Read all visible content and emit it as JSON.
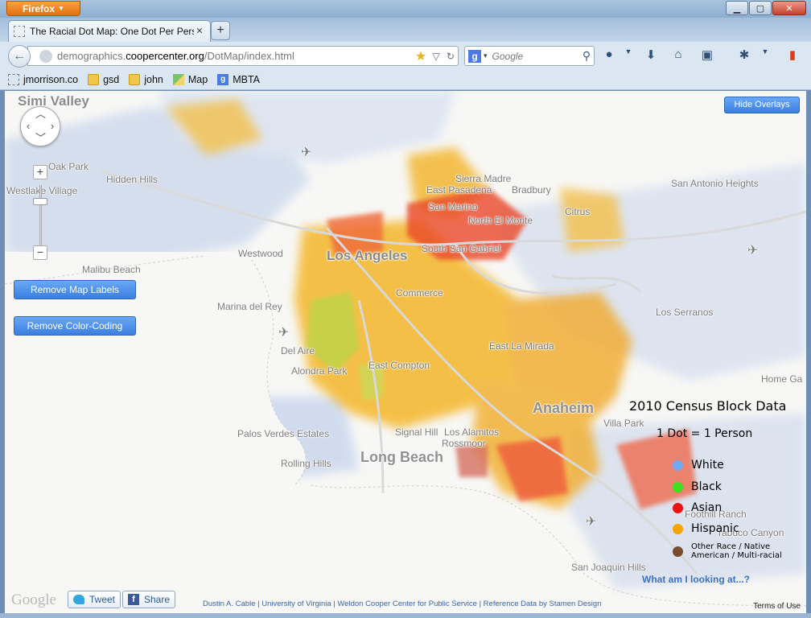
{
  "window": {
    "app_button": "Firefox",
    "controls": {
      "minimize": "▁",
      "maximize": "▢",
      "close": "✕"
    }
  },
  "tab": {
    "title": "The Racial Dot Map: One Dot Per Person...",
    "close": "✕",
    "new_tab": "+"
  },
  "nav": {
    "url_prefix": "demographics.",
    "url_domain": "coopercenter.org",
    "url_suffix": "/DotMap/index.html",
    "search_engine": "g",
    "search_placeholder": "Google"
  },
  "bookmarks": [
    {
      "label": "jmorrison.co",
      "icon": "page-icon"
    },
    {
      "label": "gsd",
      "icon": "folder-icon"
    },
    {
      "label": "john",
      "icon": "folder-icon"
    },
    {
      "label": "Map",
      "icon": "maps-icon"
    },
    {
      "label": "MBTA",
      "icon": "google-icon"
    }
  ],
  "map": {
    "buttons": {
      "hide_overlays": "Hide Overlays",
      "remove_labels": "Remove Map Labels",
      "remove_color": "Remove Color-Coding"
    },
    "zoom": {
      "in": "+",
      "out": "−"
    },
    "places": {
      "simi_valley": "Simi Valley",
      "oak_park": "Oak Park",
      "hidden_hills": "Hidden Hills",
      "westlake_village": "Westlake Village",
      "sierra_madre": "Sierra Madre",
      "east_pasadena": "East Pasadena",
      "bradbury": "Bradbury",
      "san_antonio_heights": "San Antonio Heights",
      "san_marino": "San Marino",
      "north_el_monte": "North El Monte",
      "citrus": "Citrus",
      "westwood": "Westwood",
      "los_angeles": "Los Angeles",
      "south_san_gabriel": "South San Gabriel",
      "malibu_beach": "Malibu Beach",
      "commerce": "Commerce",
      "marina_del_rey": "Marina del Rey",
      "los_serranos": "Los Serranos",
      "del_aire": "Del Aire",
      "east_la_mirada": "East La Mirada",
      "alondra_park": "Alondra Park",
      "east_compton": "East Compton",
      "home_gardens": "Home Ga",
      "anaheim": "Anaheim",
      "villa_park": "Villa Park",
      "signal_hill": "Signal Hill",
      "los_alamitos": "Los Alamitos",
      "palos_verdes_estates": "Palos Verdes Estates",
      "rossmoor": "Rossmoor",
      "rolling_hills": "Rolling Hills",
      "long_beach": "Long Beach",
      "foothill_ranch": "Foothill Ranch",
      "trabuco_canyon": "rabuco Canyon",
      "san_joaquin_hills": "San Joaquin Hills"
    }
  },
  "legend": {
    "title": "2010 Census Block Data",
    "subtitle": "1 Dot = 1 Person",
    "items": [
      {
        "label": "White",
        "color": "#73a9f2"
      },
      {
        "label": "Black",
        "color": "#3ee01f"
      },
      {
        "label": "Asian",
        "color": "#ee1111"
      },
      {
        "label": "Hispanic",
        "color": "#f5a300"
      }
    ],
    "other": {
      "line1": "Other Race / Native",
      "line2": "American / Multi-racial",
      "color": "#7a4b2c"
    },
    "link": "What am I looking at...?"
  },
  "footer": {
    "google": "Google",
    "tweet": "Tweet",
    "share": "Share",
    "attribution": "Dustin A. Cable | University of Virginia | Weldon Cooper Center for Public Service | Reference Data by Stamen Design",
    "terms": "Terms of Use"
  }
}
